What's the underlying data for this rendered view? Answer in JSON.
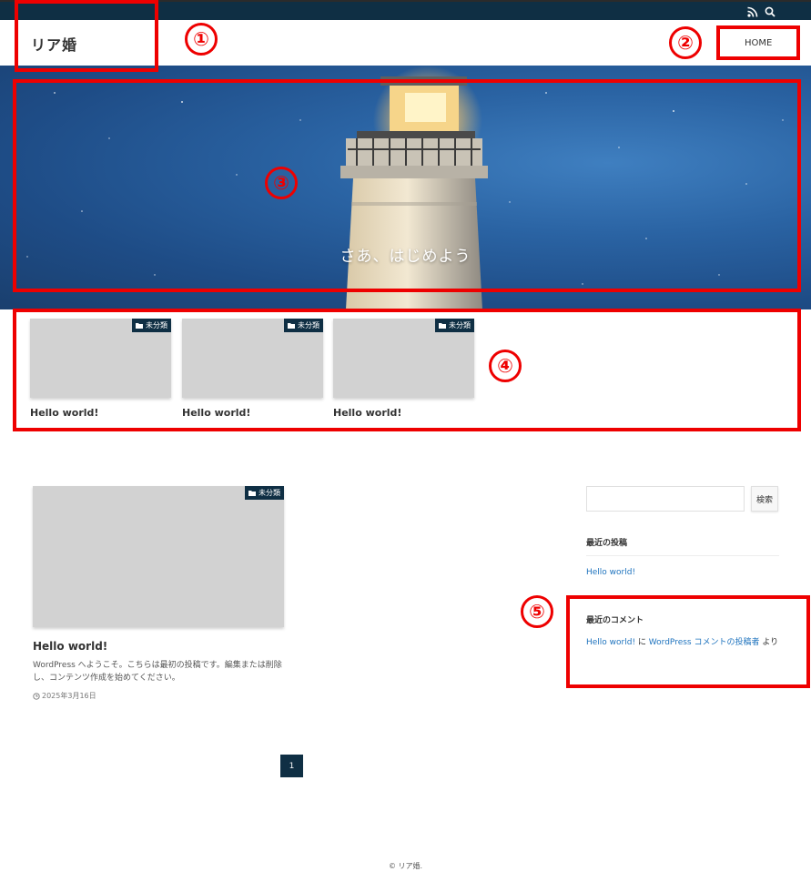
{
  "header": {
    "site_title": "リア婚",
    "nav_home": "HOME"
  },
  "topbar": {
    "icons": [
      "rss-icon",
      "search-icon"
    ]
  },
  "hero": {
    "text": "さあ、はじめよう"
  },
  "pickup": {
    "items": [
      {
        "category": "未分類",
        "title": "Hello world!"
      },
      {
        "category": "未分類",
        "title": "Hello world!"
      },
      {
        "category": "未分類",
        "title": "Hello world!"
      }
    ]
  },
  "post": {
    "category": "未分類",
    "title": "Hello world!",
    "excerpt": "WordPress へようこそ。こちらは最初の投稿です。編集または削除し、コンテンツ作成を始めてください。",
    "date": "2025年3月16日"
  },
  "sidebar": {
    "search_button": "検索",
    "recent_posts_title": "最近の投稿",
    "recent_post_link": "Hello world!",
    "recent_comments_title": "最近のコメント",
    "comment_post": "Hello world!",
    "comment_connector": " に ",
    "comment_author": "WordPress コメントの投稿者",
    "comment_suffix": " より"
  },
  "pagination": {
    "current": "1"
  },
  "footer": {
    "copyright": "© リア婚."
  },
  "annotations": {
    "labels": [
      "①",
      "②",
      "③",
      "④",
      "⑤"
    ]
  },
  "colors": {
    "navy": "#0f2f44",
    "link": "#1e73be",
    "annotation_red": "#ee0000",
    "thumb_gray": "#d2d2d2"
  }
}
